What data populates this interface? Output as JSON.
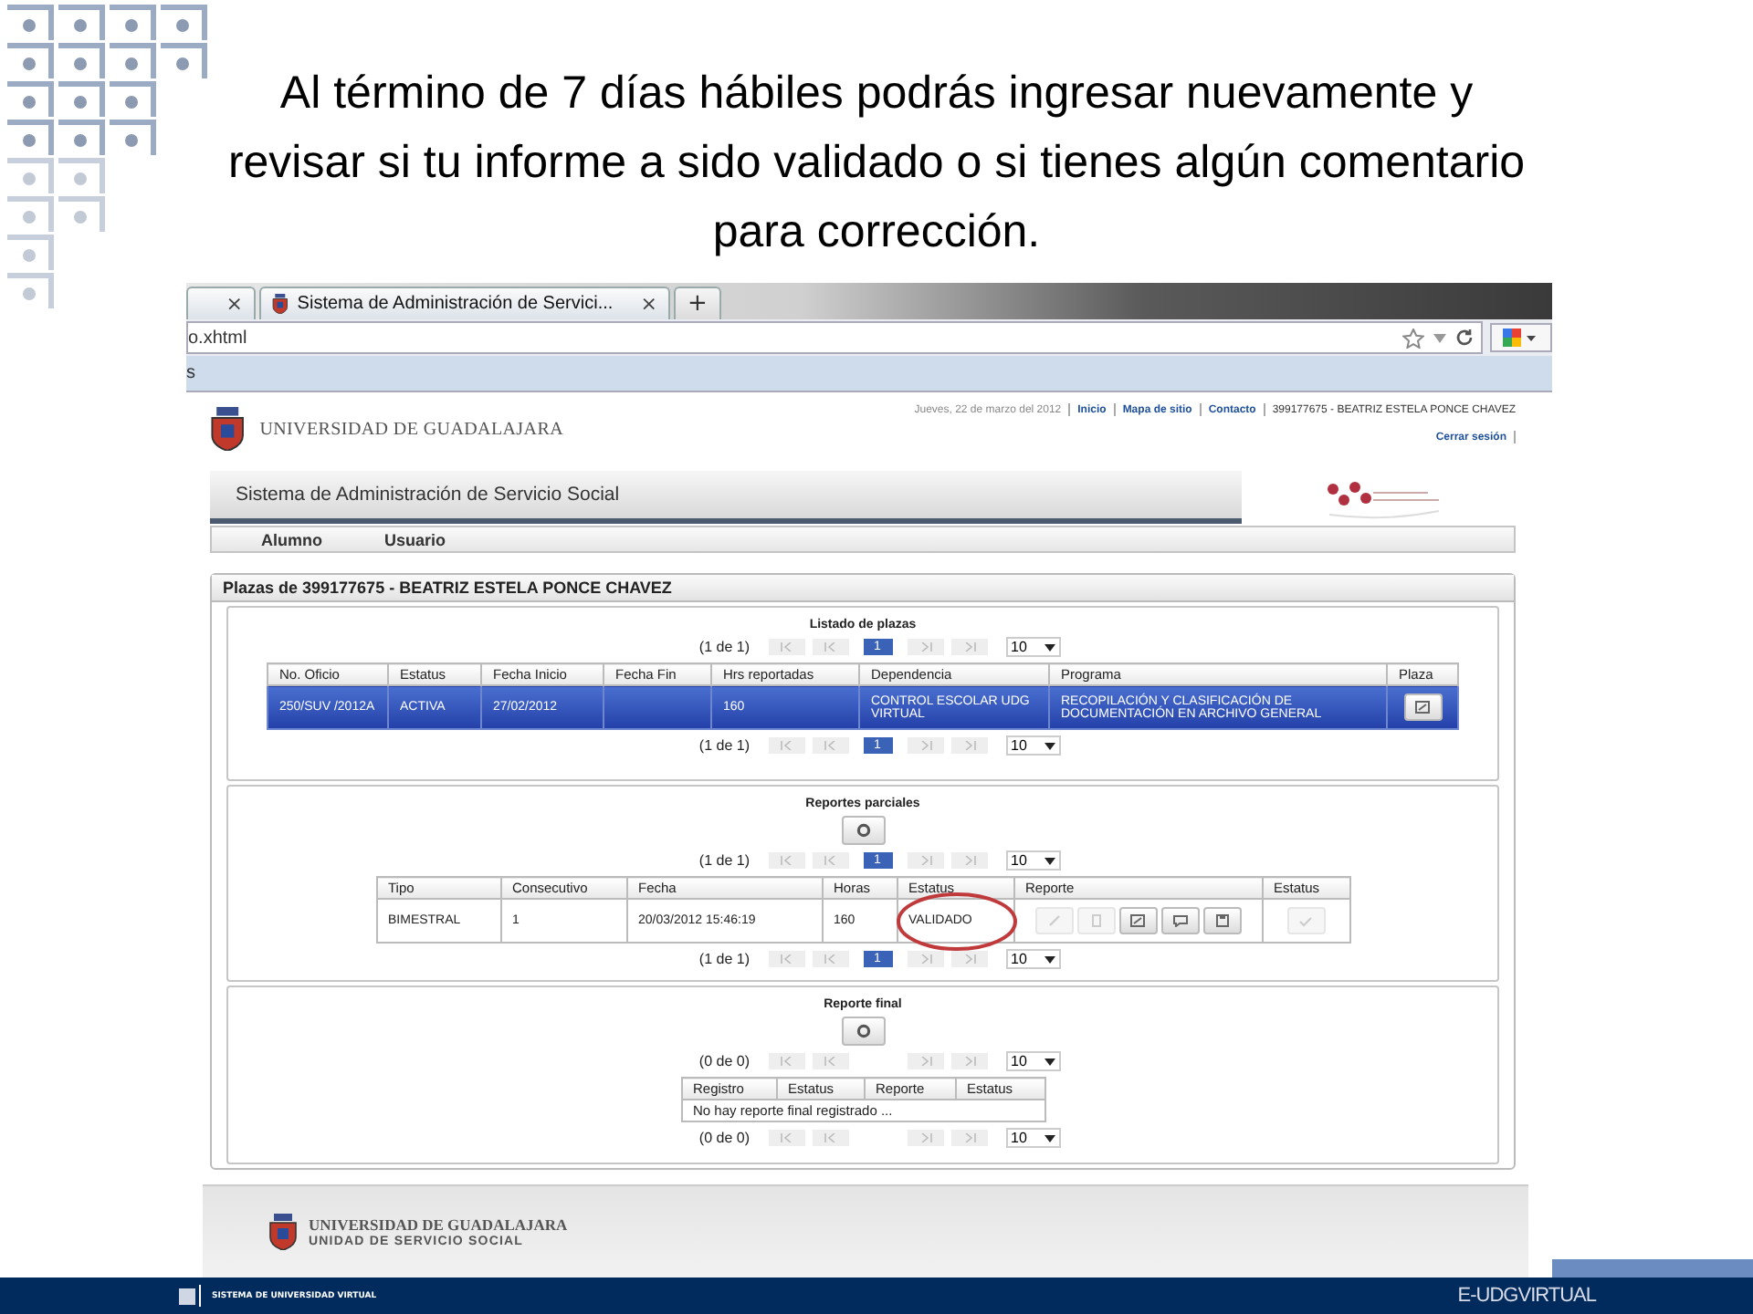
{
  "slide_title_lines": [
    "Al término de 7 días hábiles podrás ingresar nuevamente y",
    "revisar si tu informe a sido validado o si tienes algún comentario",
    "para corrección."
  ],
  "browser": {
    "tabs": [
      {
        "kind": "cut",
        "close": "×"
      },
      {
        "kind": "page",
        "label": "Sistema de Administración de Servici...",
        "close": "×"
      }
    ],
    "new_tab": "+",
    "address": "o.xhtml",
    "bookmarks": "s"
  },
  "site": {
    "university": "UNIVERSIDAD DE GUADALAJARA",
    "date": "Jueves, 22 de marzo del 2012",
    "links": [
      "Inicio",
      "Mapa de sitio",
      "Contacto"
    ],
    "user": "399177675 - BEATRIZ ESTELA PONCE CHAVEZ",
    "logout": "Cerrar sesión",
    "system_title": "Sistema de Administración de Servicio Social",
    "menu": [
      "Alumno",
      "Usuario"
    ]
  },
  "panel": {
    "title": "Plazas de 399177675 - BEATRIZ ESTELA PONCE CHAVEZ",
    "sections": [
      {
        "kind": "plazas",
        "title": "Listado de plazas",
        "pagers": [
          {
            "count": "(1 de 1)",
            "page": "1",
            "per_page": "10"
          },
          {
            "count": "(1 de 1)",
            "page": "1",
            "per_page": "10"
          }
        ],
        "table": {
          "columns": [
            "No. Oficio",
            "Estatus",
            "Fecha Inicio",
            "Fecha Fin",
            "Hrs reportadas",
            "Dependencia",
            "Programa",
            "Plaza"
          ],
          "rows": [
            {
              "selected": true,
              "cells": [
                {
                  "kind": "text",
                  "text": "250/SUV /2012A"
                },
                {
                  "kind": "text",
                  "text": "ACTIVA"
                },
                {
                  "kind": "text",
                  "text": "27/02/2012"
                },
                {
                  "kind": "empty"
                },
                {
                  "kind": "text",
                  "text": "160"
                },
                {
                  "kind": "text",
                  "text": "CONTROL ESCOLAR UDG VIRTUAL"
                },
                {
                  "kind": "text",
                  "text": "RECOPILACIÓN Y CLASIFICACIÓN DE DOCUMENTACIÓN EN ARCHIVO GENERAL"
                },
                {
                  "kind": "buttons",
                  "buttons": [
                    {
                      "kind": "edit",
                      "disabled": false
                    }
                  ]
                }
              ]
            }
          ]
        }
      },
      {
        "kind": "parciales",
        "title": "Reportes parciales",
        "add_button": true,
        "pagers": [
          {
            "count": "(1 de 1)",
            "page": "1",
            "per_page": "10"
          },
          {
            "count": "(1 de 1)",
            "page": "1",
            "per_page": "10"
          }
        ],
        "table": {
          "columns": [
            "Tipo",
            "Consecutivo",
            "Fecha",
            "Horas",
            "Estatus",
            "Reporte",
            "Estatus"
          ],
          "rows": [
            {
              "selected": false,
              "cells": [
                {
                  "kind": "text",
                  "text": "BIMESTRAL"
                },
                {
                  "kind": "text",
                  "text": "1"
                },
                {
                  "kind": "text",
                  "text": "20/03/2012 15:46:19"
                },
                {
                  "kind": "text",
                  "text": "160"
                },
                {
                  "kind": "text",
                  "text": "VALIDADO",
                  "highlighted": true
                },
                {
                  "kind": "buttons",
                  "buttons": [
                    {
                      "kind": "pencil",
                      "disabled": true
                    },
                    {
                      "kind": "document",
                      "disabled": true
                    },
                    {
                      "kind": "edit",
                      "disabled": false
                    },
                    {
                      "kind": "comment",
                      "disabled": false
                    },
                    {
                      "kind": "save",
                      "disabled": false
                    }
                  ]
                },
                {
                  "kind": "buttons",
                  "buttons": [
                    {
                      "kind": "check",
                      "disabled": true
                    }
                  ]
                }
              ]
            }
          ]
        }
      },
      {
        "kind": "final",
        "title": "Reporte final",
        "add_button": true,
        "pagers": [
          {
            "count": "(0 de 0)",
            "per_page": "10"
          },
          {
            "count": "(0 de 0)",
            "per_page": "10"
          }
        ],
        "table": {
          "columns": [
            "Registro",
            "Estatus",
            "Reporte",
            "Estatus"
          ],
          "empty": "No hay reporte final registrado ..."
        }
      }
    ]
  },
  "page_footer": {
    "university": "UNIVERSIDAD DE GUADALAJARA",
    "unit": "UNIDAD DE SERVICIO SOCIAL"
  },
  "slide_footer": {
    "left": "SISTEMA DE UNIVERSIDAD VIRTUAL",
    "right": "E-UDGVIRTUAL"
  }
}
